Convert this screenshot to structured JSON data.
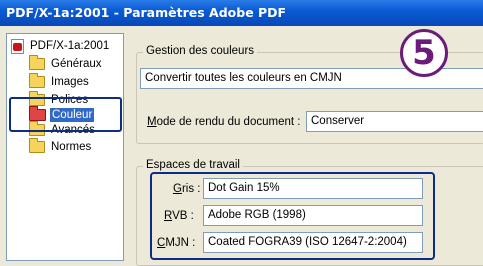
{
  "window": {
    "title": "PDF/X-1a:2001 - Paramètres Adobe PDF"
  },
  "tree": {
    "root_label": "PDF/X-1a:2001",
    "items": [
      {
        "label": "Généraux",
        "icon": "folder-icon"
      },
      {
        "label": "Images",
        "icon": "folder-icon"
      },
      {
        "label": "Polices",
        "icon": "folder-icon"
      },
      {
        "label": "Couleur",
        "icon": "folder-open-icon",
        "selected": true
      },
      {
        "label": "Avancés",
        "icon": "folder-icon"
      },
      {
        "label": "Normes",
        "icon": "folder-icon"
      }
    ]
  },
  "color_management": {
    "legend": "Gestion des couleurs",
    "policy_value": "Convertir toutes les couleurs en CMJN",
    "render_mode_label_underlined": "M",
    "render_mode_label_rest": "ode de rendu du document :",
    "render_mode_value": "Conserver"
  },
  "working_spaces": {
    "legend": "Espaces de travail",
    "gray_label_underlined": "G",
    "gray_label_rest": "ris :",
    "gray_value": "Dot Gain 15%",
    "rgb_label_underlined": "R",
    "rgb_label_rest": "VB :",
    "rgb_value": "Adobe RGB (1998)",
    "cmyk_label_underlined": "C",
    "cmyk_label_rest": "MJN :",
    "cmyk_value": "Coated FOGRA39 (ISO 12647-2:2004)"
  },
  "callout_badge": "5",
  "colors": {
    "titlebar": "#0a5bd4",
    "selection": "#316ac5",
    "highlight_box": "#0c2d83",
    "badge": "#6b1c7a"
  }
}
